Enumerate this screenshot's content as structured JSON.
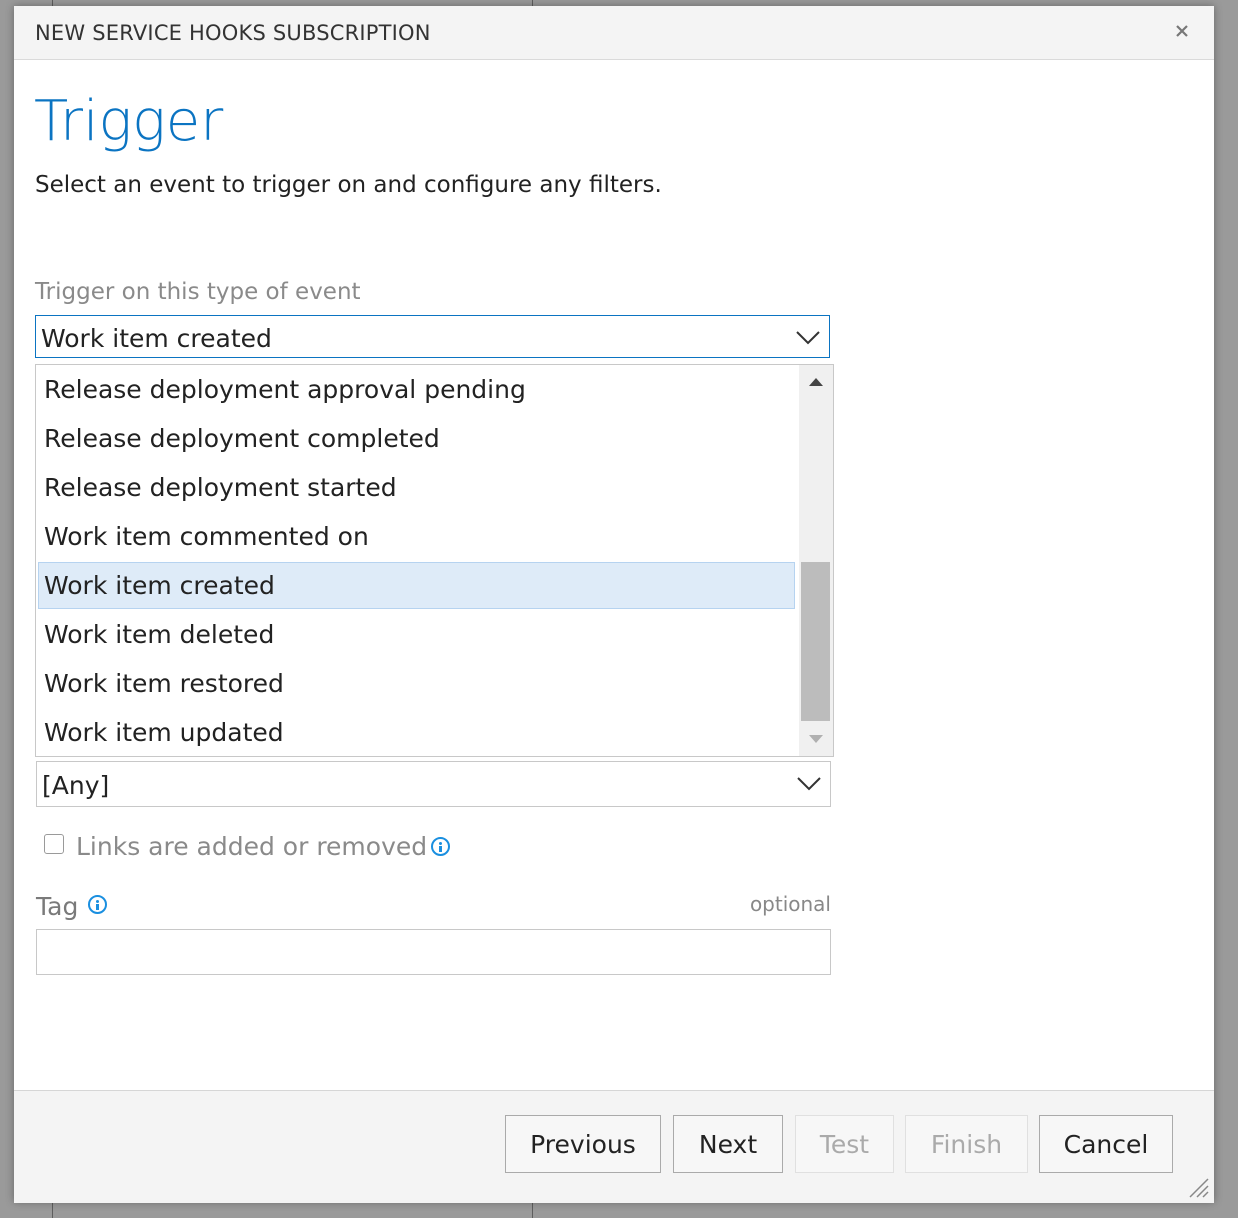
{
  "dialog": {
    "title": "NEW SERVICE HOOKS SUBSCRIPTION",
    "close_icon": "close-icon"
  },
  "page": {
    "heading": "Trigger",
    "subheading": "Select an event to trigger on and configure any filters."
  },
  "event_select": {
    "label": "Trigger on this type of event",
    "value": "Work item created",
    "options": [
      "Release deployment approval pending",
      "Release deployment completed",
      "Release deployment started",
      "Work item commented on",
      "Work item created",
      "Work item deleted",
      "Work item restored",
      "Work item updated"
    ],
    "selected_index": 4
  },
  "filter_select": {
    "value": "[Any]"
  },
  "links_checkbox": {
    "label": "Links are added or removed",
    "checked": false
  },
  "tag": {
    "label": "Tag",
    "optional_text": "optional",
    "value": ""
  },
  "footer": {
    "previous": "Previous",
    "next": "Next",
    "test": "Test",
    "finish": "Finish",
    "cancel": "Cancel"
  },
  "colors": {
    "accent": "#0b74c2",
    "selected_row": "#deebf8",
    "info_icon": "#1a8fe0"
  }
}
